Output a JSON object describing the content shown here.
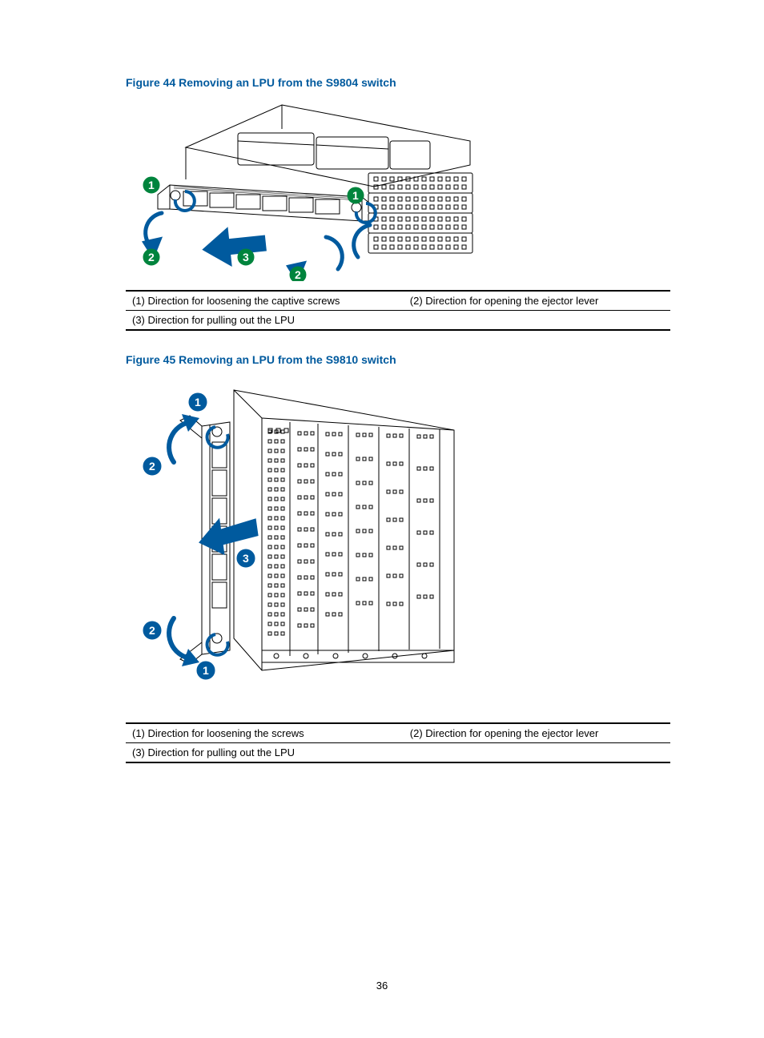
{
  "figure44": {
    "title": "Figure 44 Removing an LPU from the S9804 switch",
    "legend": {
      "row1": {
        "c1": "(1) Direction for loosening the captive screws",
        "c2": "(2) Direction for opening the ejector lever"
      },
      "row2": {
        "c1": "(3) Direction for pulling out the LPU",
        "c2": ""
      }
    }
  },
  "figure45": {
    "title": "Figure 45 Removing an LPU from the S9810 switch",
    "legend": {
      "row1": {
        "c1": "(1) Direction for loosening the screws",
        "c2": "(2) Direction for opening the ejector lever"
      },
      "row2": {
        "c1": "(3) Direction for pulling out the LPU",
        "c2": ""
      }
    }
  },
  "pageNumber": "36"
}
